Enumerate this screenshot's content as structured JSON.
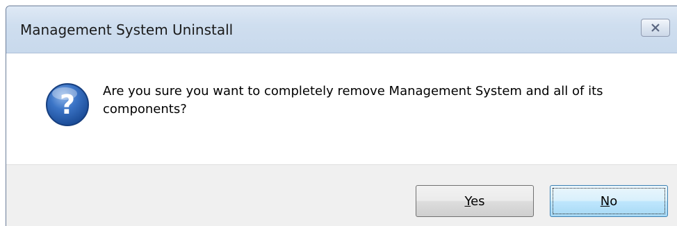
{
  "dialog": {
    "title": "Management System Uninstall",
    "message": "Are you sure you want to completely remove Management System and all of its components?",
    "icon": "question-icon",
    "close_icon": "close-icon"
  },
  "buttons": {
    "yes": {
      "mnemonic": "Y",
      "rest": "es"
    },
    "no": {
      "mnemonic": "N",
      "rest": "o"
    }
  },
  "colors": {
    "titlebar": "#cfdeef",
    "footer": "#f0f0f0",
    "default_button_border": "#3c7fb1",
    "question_icon_blue": "#2a5fae"
  }
}
